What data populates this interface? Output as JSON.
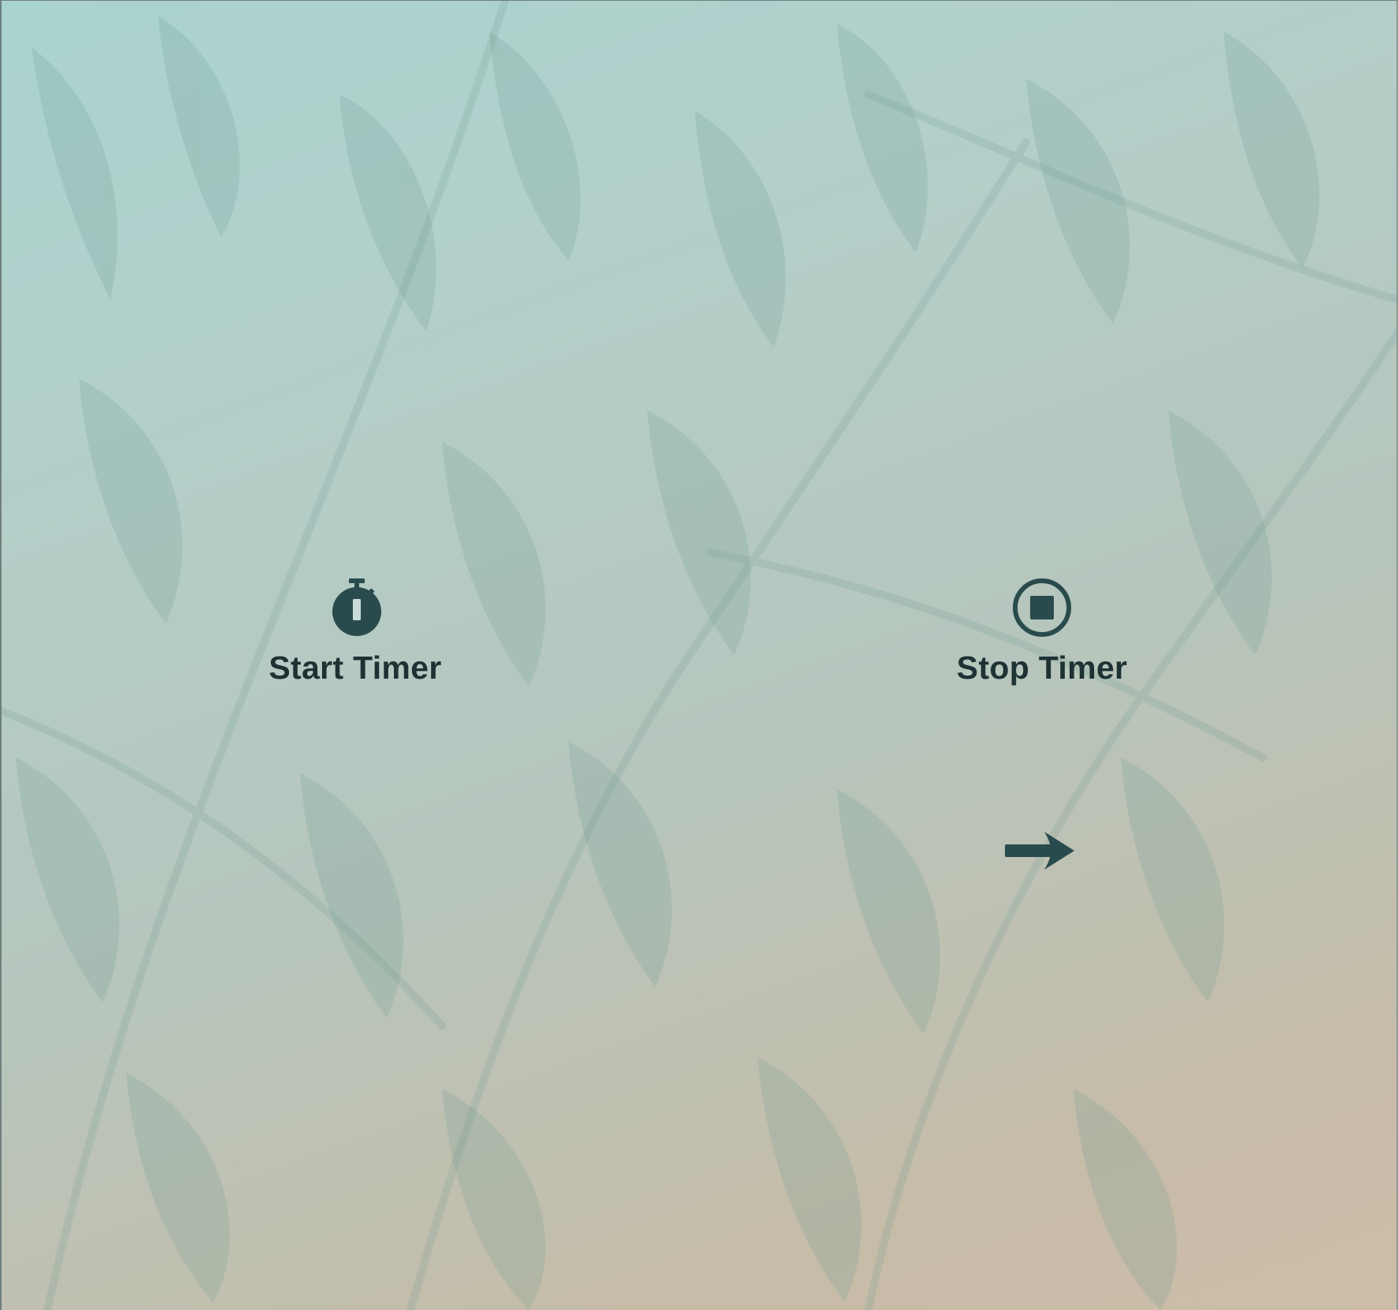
{
  "controls": {
    "start": {
      "label": "Start Timer",
      "icon": "stopwatch-icon"
    },
    "stop": {
      "label": "Stop Timer",
      "icon": "stop-circle-icon"
    }
  },
  "navigation": {
    "next_icon": "arrow-right-icon"
  },
  "colors": {
    "icon": "#2a4b4d",
    "text": "#1e3234",
    "background_top": "#a9d3cf",
    "background_bottom": "#cdbda8",
    "foliage": "#7fa59c"
  }
}
